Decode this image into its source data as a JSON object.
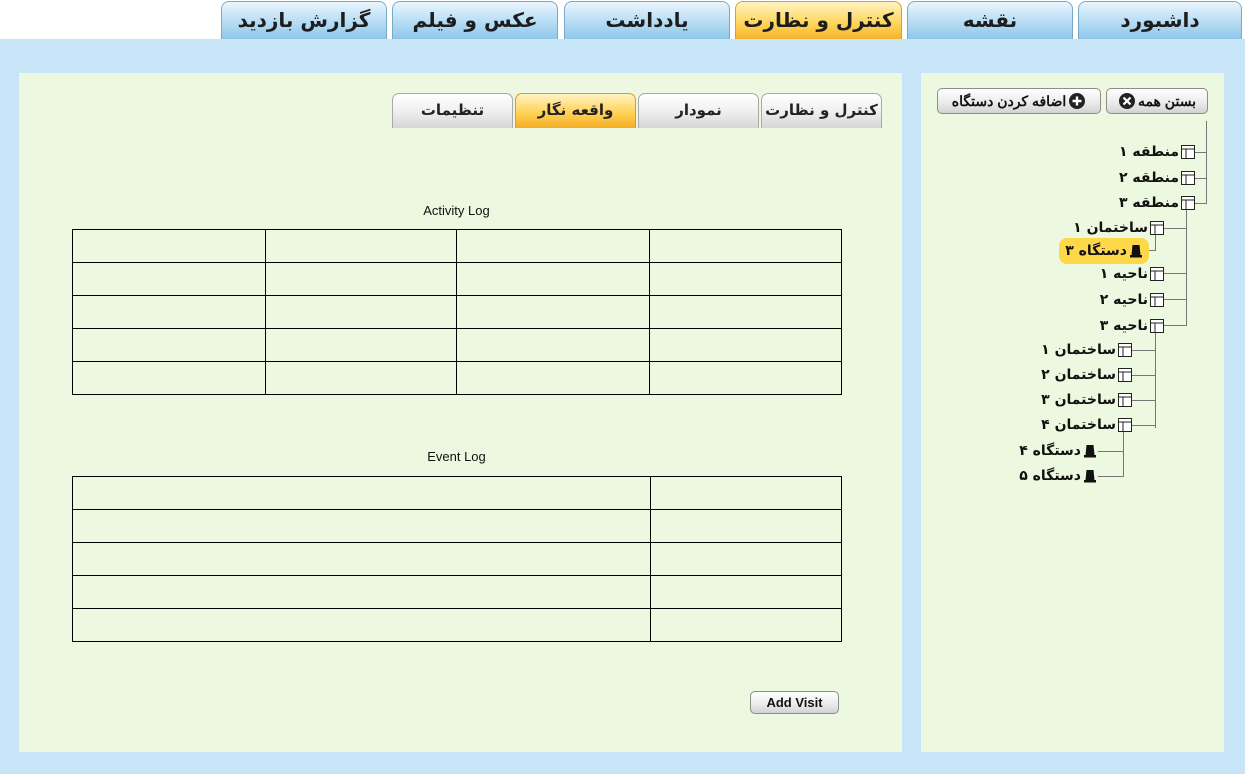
{
  "top_tabs": [
    {
      "label": "داشبورد",
      "active": false
    },
    {
      "label": "نقشه",
      "active": false
    },
    {
      "label": "یادداشت",
      "active": false
    },
    {
      "label": "کنترل و نظارت",
      "active": true
    },
    {
      "label": "عکس و فیلم",
      "active": false
    },
    {
      "label": "گزارش بازدید",
      "active": false
    }
  ],
  "inner_tabs": [
    {
      "label": "کنترل و نظارت",
      "active": false
    },
    {
      "label": "نمودار",
      "active": false
    },
    {
      "label": "واقعه نگار",
      "active": true
    },
    {
      "label": "تنظیمات",
      "active": false
    }
  ],
  "activity_log": {
    "title": "Activity Log"
  },
  "event_log": {
    "title": "Event Log"
  },
  "add_visit_label": "Add Visit",
  "tree_toolbar": {
    "close_all": "بستن همه",
    "add_device": "اضافه کردن دستگاه"
  },
  "tree": [
    {
      "label": "منطقه ۱",
      "icon": "folder-icon"
    },
    {
      "label": "منطقه ۲",
      "icon": "folder-icon"
    },
    {
      "label": "منطقه ۳",
      "icon": "folder-icon"
    },
    {
      "label": "ساختمان ۱",
      "icon": "folder-icon"
    },
    {
      "label": "دستگاه ۳",
      "icon": "device-icon",
      "selected": true
    },
    {
      "label": "ناحیه ۱",
      "icon": "folder-icon"
    },
    {
      "label": "ناحیه ۲",
      "icon": "folder-icon"
    },
    {
      "label": "ناحیه ۳",
      "icon": "folder-icon"
    },
    {
      "label": "ساختمان ۱",
      "icon": "folder-icon"
    },
    {
      "label": "ساختمان ۲",
      "icon": "folder-icon"
    },
    {
      "label": "ساختمان ۳",
      "icon": "folder-icon"
    },
    {
      "label": "ساختمان ۴",
      "icon": "folder-icon"
    },
    {
      "label": "دستگاه ۴",
      "icon": "device-icon"
    },
    {
      "label": "دستگاه ۵",
      "icon": "device-icon"
    }
  ]
}
